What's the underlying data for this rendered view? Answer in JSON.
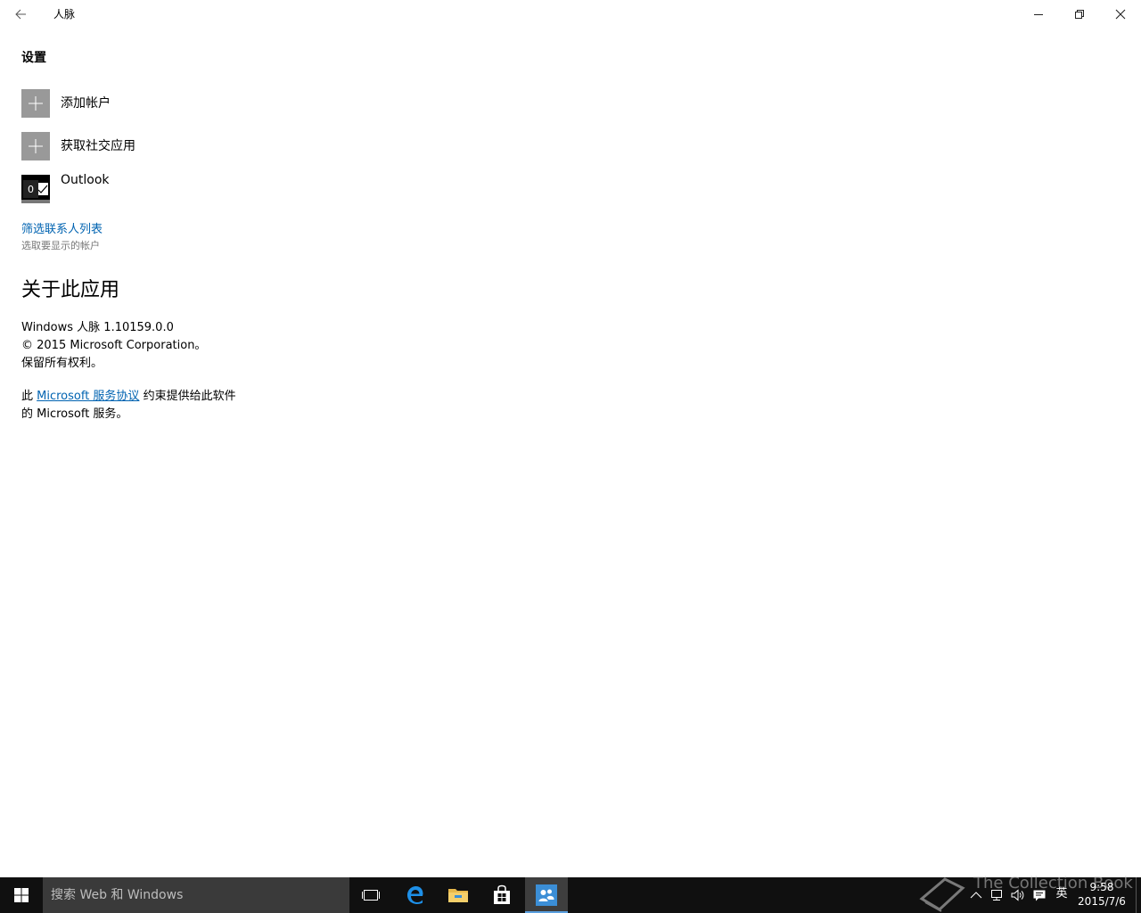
{
  "window": {
    "title": "人脉"
  },
  "settings": {
    "heading": "设置",
    "items": [
      {
        "label": "添加帐户",
        "icon": "plus-icon"
      },
      {
        "label": "获取社交应用",
        "icon": "plus-icon"
      },
      {
        "label": "Outlook",
        "icon": "outlook-icon"
      }
    ],
    "filter_link": "筛选联系人列表",
    "filter_sub": "选取要显示的帐户"
  },
  "about": {
    "heading": "关于此应用",
    "version": "Windows 人脉 1.10159.0.0",
    "copyright": "© 2015 Microsoft Corporation。",
    "rights": "保留所有权利。",
    "terms_prefix": "此 ",
    "terms_link": "Microsoft 服务协议",
    "terms_suffix": " 约束提供给此软件",
    "terms_line2": "的 Microsoft 服务。"
  },
  "taskbar": {
    "search_placeholder": "搜索 Web 和 Windows",
    "apps": [
      "task-view-icon",
      "edge-icon",
      "file-explorer-icon",
      "store-icon",
      "people-icon"
    ],
    "active_app": "people-icon",
    "ime": "英",
    "time": "9:58",
    "date": "2015/7/6",
    "watermark": "The Collection Book"
  },
  "colors": {
    "accent": "#0063b1",
    "tile_gray": "#999999",
    "taskbar_bg": "#101010",
    "search_bg": "#3a3a3a"
  }
}
